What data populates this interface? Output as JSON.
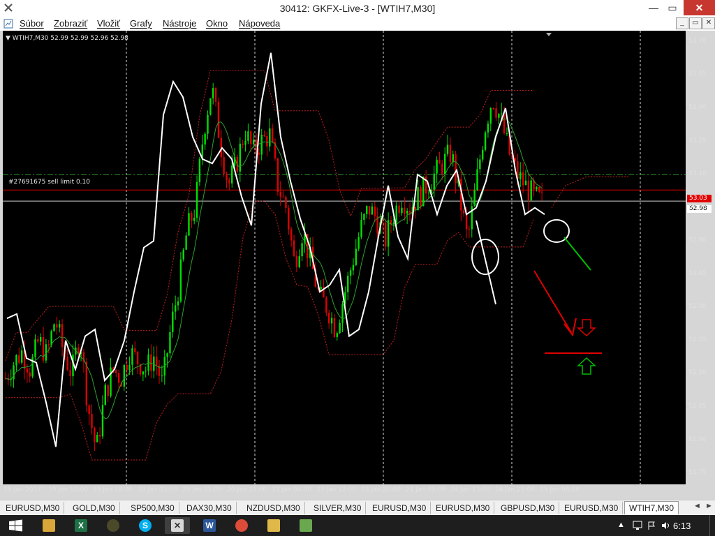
{
  "window": {
    "title": "30412: GKFX-Live-3 - [WTIH7,M30]",
    "minimize_glyph": "—",
    "maximize_glyph": "▭",
    "close_glyph": "✕"
  },
  "menu": {
    "items": [
      "Súbor",
      "Zobraziť",
      "Vložiť",
      "Grafy",
      "Nástroje",
      "Okno",
      "Nápoveda"
    ],
    "mdi_minimize": "_",
    "mdi_restore": "▭",
    "mdi_close": "✕"
  },
  "chart": {
    "header": "▼ WTIH7,M30  52.99 52.99 52.96 52.98",
    "order_label": "#27691675 sell limit 0.10",
    "bid_price": "53.03",
    "current_price": "52.98",
    "colors": {
      "background": "#000000",
      "bull_candle": "#00e000",
      "bear_candle": "#e00000",
      "white_line": "#ffffff",
      "green_ma": "#2ea02e",
      "red_dotted": "#c81e1e",
      "order_line": "#2e9a2e"
    }
  },
  "chart_data": {
    "type": "candlestick",
    "symbol": "WTIH7",
    "timeframe": "M30",
    "ylim": [
      51.7,
      53.75
    ],
    "y_ticks": [
      "53.70",
      "53.55",
      "53.40",
      "53.25",
      "53.10",
      "52.95",
      "52.80",
      "52.65",
      "52.50",
      "52.35",
      "52.20",
      "52.05",
      "51.90",
      "51.75"
    ],
    "x_ticks": [
      "19 Jan 2017",
      "19 Jan 10:00",
      "19 Jan 18:00",
      "20 Jan 03:00",
      "20 Jan 11:00",
      "20 Jan 19:00",
      "23 Jan 04:00",
      "23 Jan 12:00",
      "23 Jan 20:00",
      "24 Jan 05:00",
      "24 Jan 13:00",
      "24 Jan 21:00",
      "25 Jan 06:00"
    ],
    "last_ohlc": {
      "open": 52.99,
      "high": 52.99,
      "low": 52.96,
      "close": 52.98
    },
    "bid_line": 53.03,
    "sell_limit_order": {
      "ticket": "#27691675",
      "price": 53.1,
      "volume": 0.1
    },
    "price_path": [
      52.18,
      52.25,
      52.3,
      52.22,
      52.35,
      52.28,
      52.45,
      52.3,
      52.2,
      52.38,
      52.05,
      51.85,
      52.1,
      52.22,
      52.18,
      52.3,
      52.26,
      52.22,
      52.28,
      52.15,
      52.4,
      52.6,
      52.85,
      52.95,
      53.3,
      53.5,
      53.25,
      53.05,
      53.15,
      53.3,
      53.2,
      53.25,
      53.28,
      53.05,
      52.95,
      52.7,
      52.85,
      52.7,
      52.55,
      52.5,
      52.4,
      52.55,
      52.7,
      52.85,
      52.95,
      52.9,
      52.8,
      52.92,
      53.0,
      52.95,
      53.0,
      53.05,
      53.1,
      53.15,
      53.2,
      53.0,
      52.8,
      53.05,
      53.3,
      53.45,
      53.35,
      53.2,
      53.1,
      53.05,
      53.0,
      52.98
    ],
    "white_overlay": [
      52.4,
      52.5,
      52.3,
      52.2,
      52.1,
      51.9,
      52.3,
      52.25,
      52.4,
      52.35,
      52.2,
      52.25,
      52.3,
      52.6,
      52.8,
      52.75,
      53.4,
      53.55,
      53.4,
      53.3,
      53.2,
      53.1,
      53.25,
      53.2,
      52.95,
      52.9,
      53.45,
      53.6,
      53.3,
      53.1,
      52.85,
      52.8,
      52.6,
      52.55,
      52.7,
      52.4,
      52.35,
      52.6,
      52.85,
      53.0,
      52.85,
      52.75,
      53.05,
      53.1,
      52.95,
      53.0,
      53.15,
      52.95,
      52.9,
      53.1,
      53.3,
      53.35,
      53.15,
      52.95,
      52.9,
      52.95
    ]
  },
  "tabs": {
    "items": [
      "EURUSD,M30",
      "GOLD,M30",
      "SP500,M30",
      "DAX30,M30",
      "NZDUSD,M30",
      "SILVER,M30",
      "EURUSD,M30",
      "EURUSD,M30",
      "GBPUSD,M30",
      "EURUSD,M30",
      "WTIH7,M30"
    ],
    "active": "WTIH7,M30",
    "scroll_left": "◄",
    "scroll_right": "►"
  },
  "taskbar": {
    "apps": [
      "file-explorer",
      "excel",
      "chrome-settings",
      "skype",
      "metatrader",
      "word",
      "chrome",
      "folder",
      "app-grid"
    ],
    "tray_arrow": "▲",
    "clock": "6:13"
  }
}
